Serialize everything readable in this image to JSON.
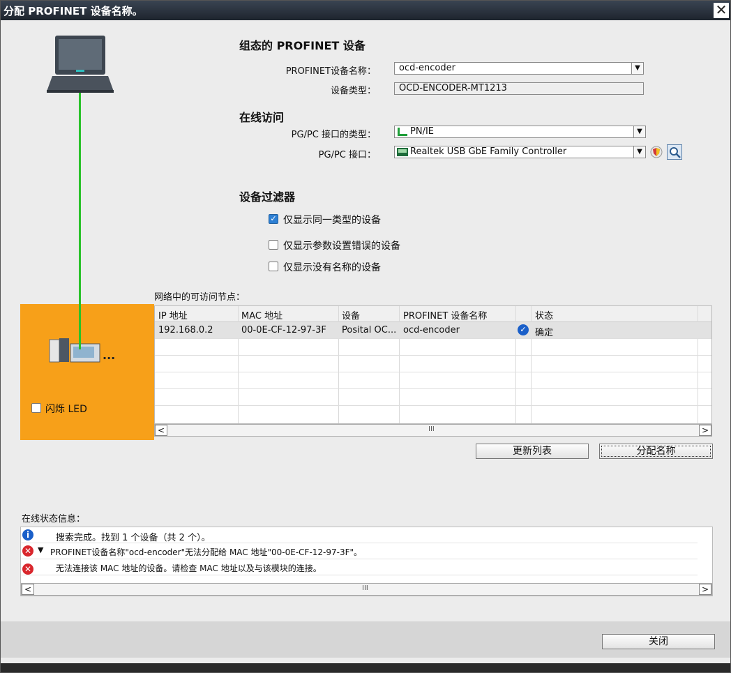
{
  "window": {
    "title": "分配 PROFINET 设备名称。",
    "close_glyph": "✕"
  },
  "configured": {
    "heading": "组态的 PROFINET 设备",
    "name_label": "PROFINET设备名称：",
    "name_value": "ocd-encoder",
    "type_label": "设备类型：",
    "type_value": "OCD-ENCODER-MT1213"
  },
  "online": {
    "heading": "在线访问",
    "if_type_label": "PG/PC 接口的类型：",
    "if_type_value": "PN/IE",
    "if_label": "PG/PC 接口：",
    "if_value": "Realtek USB GbE Family Controller"
  },
  "filter": {
    "heading": "设备过滤器",
    "options": [
      {
        "label": "仅显示同一类型的设备",
        "checked": true
      },
      {
        "label": "仅显示参数设置错误的设备",
        "checked": false
      },
      {
        "label": "仅显示没有名称的设备",
        "checked": false
      }
    ]
  },
  "device_panel": {
    "flash_led_label": "闪烁 LED",
    "more": "..."
  },
  "nodes": {
    "heading": "网络中的可访问节点：",
    "columns": [
      "IP 地址",
      "MAC 地址",
      "设备",
      "PROFINET 设备名称",
      "",
      "状态"
    ],
    "rows": [
      {
        "ip": "192.168.0.2",
        "mac": "00-0E-CF-12-97-3F",
        "device": "Posital OC...",
        "name": "ocd-encoder",
        "status": "确定"
      }
    ],
    "scroll_left": "<",
    "scroll_right": ">",
    "scroll_grip": "III"
  },
  "buttons": {
    "refresh": "更新列表",
    "assign": "分配名称",
    "close": "关闭"
  },
  "status_info": {
    "heading": "在线状态信息：",
    "messages": [
      {
        "type": "info",
        "text": "搜索完成。找到 1 个设备（共 2 个）。"
      },
      {
        "type": "error",
        "text": "PROFINET设备名称\"ocd-encoder\"无法分配给 MAC 地址\"00-0E-CF-12-97-3F\"。"
      },
      {
        "type": "error",
        "text": "无法连接该 MAC 地址的设备。请检查 MAC 地址以及与该模块的连接。"
      }
    ]
  },
  "colors": {
    "accent_orange": "#f7a019",
    "link_green": "#29c229",
    "info_blue": "#1a5fc9",
    "error_red": "#d9262c"
  }
}
